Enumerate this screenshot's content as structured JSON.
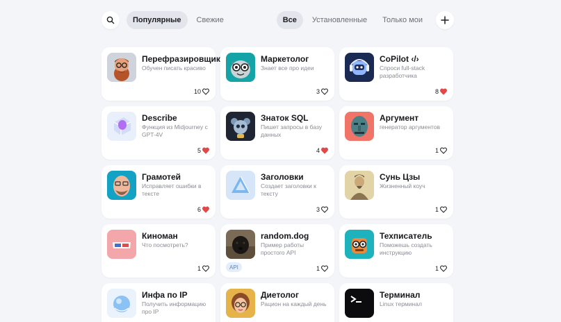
{
  "header": {
    "filters_left": [
      {
        "label": "Популярные",
        "active": true
      },
      {
        "label": "Свежие",
        "active": false
      }
    ],
    "filters_right": [
      {
        "label": "Все",
        "active": true
      },
      {
        "label": "Установленные",
        "active": false
      },
      {
        "label": "Только мои",
        "active": false
      }
    ],
    "search_icon": "search-icon",
    "add_icon": "plus-icon"
  },
  "colors": {
    "background": "#f4f5f9",
    "card": "#ffffff",
    "liked_heart": "#e0484a",
    "active_pill": "#e3e5ec"
  },
  "cards": [
    {
      "title": "Перефразировщик",
      "desc": "Обучен писать красиво",
      "likes": "10",
      "liked": false,
      "tag": "",
      "icon": "bearded-man-avatar"
    },
    {
      "title": "Маркетолог",
      "desc": "Знает все про идеи",
      "likes": "3",
      "liked": false,
      "tag": "",
      "icon": "owl-glasses-avatar"
    },
    {
      "title": "CoPilot ‹/›",
      "desc": "Спроси full-stack разработчика",
      "likes": "8",
      "liked": true,
      "tag": "",
      "icon": "robot-headphones-avatar"
    },
    {
      "title": "Describe",
      "desc": "Функция из Midjourney с GPT-4V",
      "likes": "5",
      "liked": true,
      "tag": "",
      "icon": "glass-cube-avatar"
    },
    {
      "title": "Знаток SQL",
      "desc": "Пишет запросы в базу данных",
      "likes": "4",
      "liked": true,
      "tag": "",
      "icon": "robot-mouse-avatar"
    },
    {
      "title": "Аргумент",
      "desc": "генератор аргументов",
      "likes": "1",
      "liked": false,
      "tag": "",
      "icon": "tribal-mask-avatar"
    },
    {
      "title": "Грамотей",
      "desc": "Исправляет ошибки в тексте",
      "likes": "6",
      "liked": true,
      "tag": "",
      "icon": "bald-man-avatar"
    },
    {
      "title": "Заголовки",
      "desc": "Создает заголовки к тексту",
      "likes": "3",
      "liked": false,
      "tag": "",
      "icon": "glass-triangle-avatar"
    },
    {
      "title": "Сунь Цзы",
      "desc": "Жизненный коуч",
      "likes": "1",
      "liked": false,
      "tag": "",
      "icon": "sun-tzu-avatar"
    },
    {
      "title": "Киноман",
      "desc": "Что посмотреть?",
      "likes": "1",
      "liked": false,
      "tag": "",
      "icon": "3d-glasses-avatar"
    },
    {
      "title": "random.dog",
      "desc": "Пример работы простого API",
      "likes": "1",
      "liked": false,
      "tag": "API",
      "icon": "dog-photo-avatar"
    },
    {
      "title": "Техписатель",
      "desc": "Поможешь создать инструкцию",
      "likes": "1",
      "liked": false,
      "tag": "",
      "icon": "robot-glasses-avatar"
    },
    {
      "title": "Инфа по IP",
      "desc": "Получить информацию про IP",
      "likes": "",
      "liked": false,
      "tag": "",
      "icon": "glass-sphere-avatar"
    },
    {
      "title": "Диетолог",
      "desc": "Рацион на каждый день",
      "likes": "",
      "liked": false,
      "tag": "",
      "icon": "woman-glasses-avatar"
    },
    {
      "title": "Терминал",
      "desc": "Linux терминал",
      "likes": "",
      "liked": false,
      "tag": "",
      "icon": "terminal-avatar"
    }
  ]
}
